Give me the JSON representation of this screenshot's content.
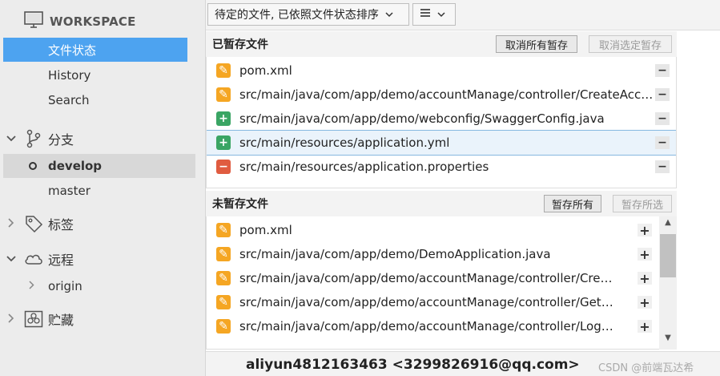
{
  "sidebar": {
    "workspace_title": "WORKSPACE",
    "nav": [
      {
        "label": "文件状态",
        "active": true
      },
      {
        "label": "History",
        "active": false
      },
      {
        "label": "Search",
        "active": false
      }
    ],
    "branches_section": {
      "label": "分支",
      "expanded": true,
      "icon": "branch-icon"
    },
    "branches": [
      {
        "label": "develop",
        "current": true
      },
      {
        "label": "master",
        "current": false
      }
    ],
    "tags_section": {
      "label": "标签",
      "expanded": false,
      "icon": "tag-icon"
    },
    "remotes_section": {
      "label": "远程",
      "expanded": true,
      "icon": "cloud-icon"
    },
    "remotes": [
      {
        "label": "origin"
      }
    ],
    "stashes_section": {
      "label": "贮藏",
      "expanded": false,
      "icon": "stash-icon"
    }
  },
  "toolbar": {
    "sort_dropdown": "待定的文件, 已依照文件状态排序",
    "view_dropdown_icon": "list-icon"
  },
  "staged": {
    "title": "已暂存文件",
    "unstage_all": "取消所有暂存",
    "unstage_selected": "取消选定暂存",
    "files": [
      {
        "status": "modified",
        "path": "pom.xml"
      },
      {
        "status": "modified",
        "path": "src/main/java/com/app/demo/accountManage/controller/CreateAcco..."
      },
      {
        "status": "added",
        "path": "src/main/java/com/app/demo/webconfig/SwaggerConfig.java"
      },
      {
        "status": "added",
        "path": "src/main/resources/application.yml",
        "selected": true
      },
      {
        "status": "deleted",
        "path": "src/main/resources/application.properties"
      }
    ]
  },
  "unstaged": {
    "title": "未暂存文件",
    "stage_all": "暂存所有",
    "stage_selected": "暂存所选",
    "files": [
      {
        "status": "modified",
        "path": "pom.xml"
      },
      {
        "status": "modified",
        "path": "src/main/java/com/app/demo/DemoApplication.java"
      },
      {
        "status": "modified",
        "path": "src/main/java/com/app/demo/accountManage/controller/CreateAc..."
      },
      {
        "status": "modified",
        "path": "src/main/java/com/app/demo/accountManage/controller/GetCook..."
      },
      {
        "status": "modified",
        "path": "src/main/java/com/app/demo/accountManage/controller/LoginCo..."
      }
    ]
  },
  "commit": {
    "author": "aliyun4812163463 <3299826916@qq.com>"
  },
  "watermark": "CSDN @前端瓦达希",
  "colors": {
    "accent": "#4da3f0",
    "modified": "#f5a623",
    "added": "#3aa564",
    "deleted": "#e05c40"
  }
}
